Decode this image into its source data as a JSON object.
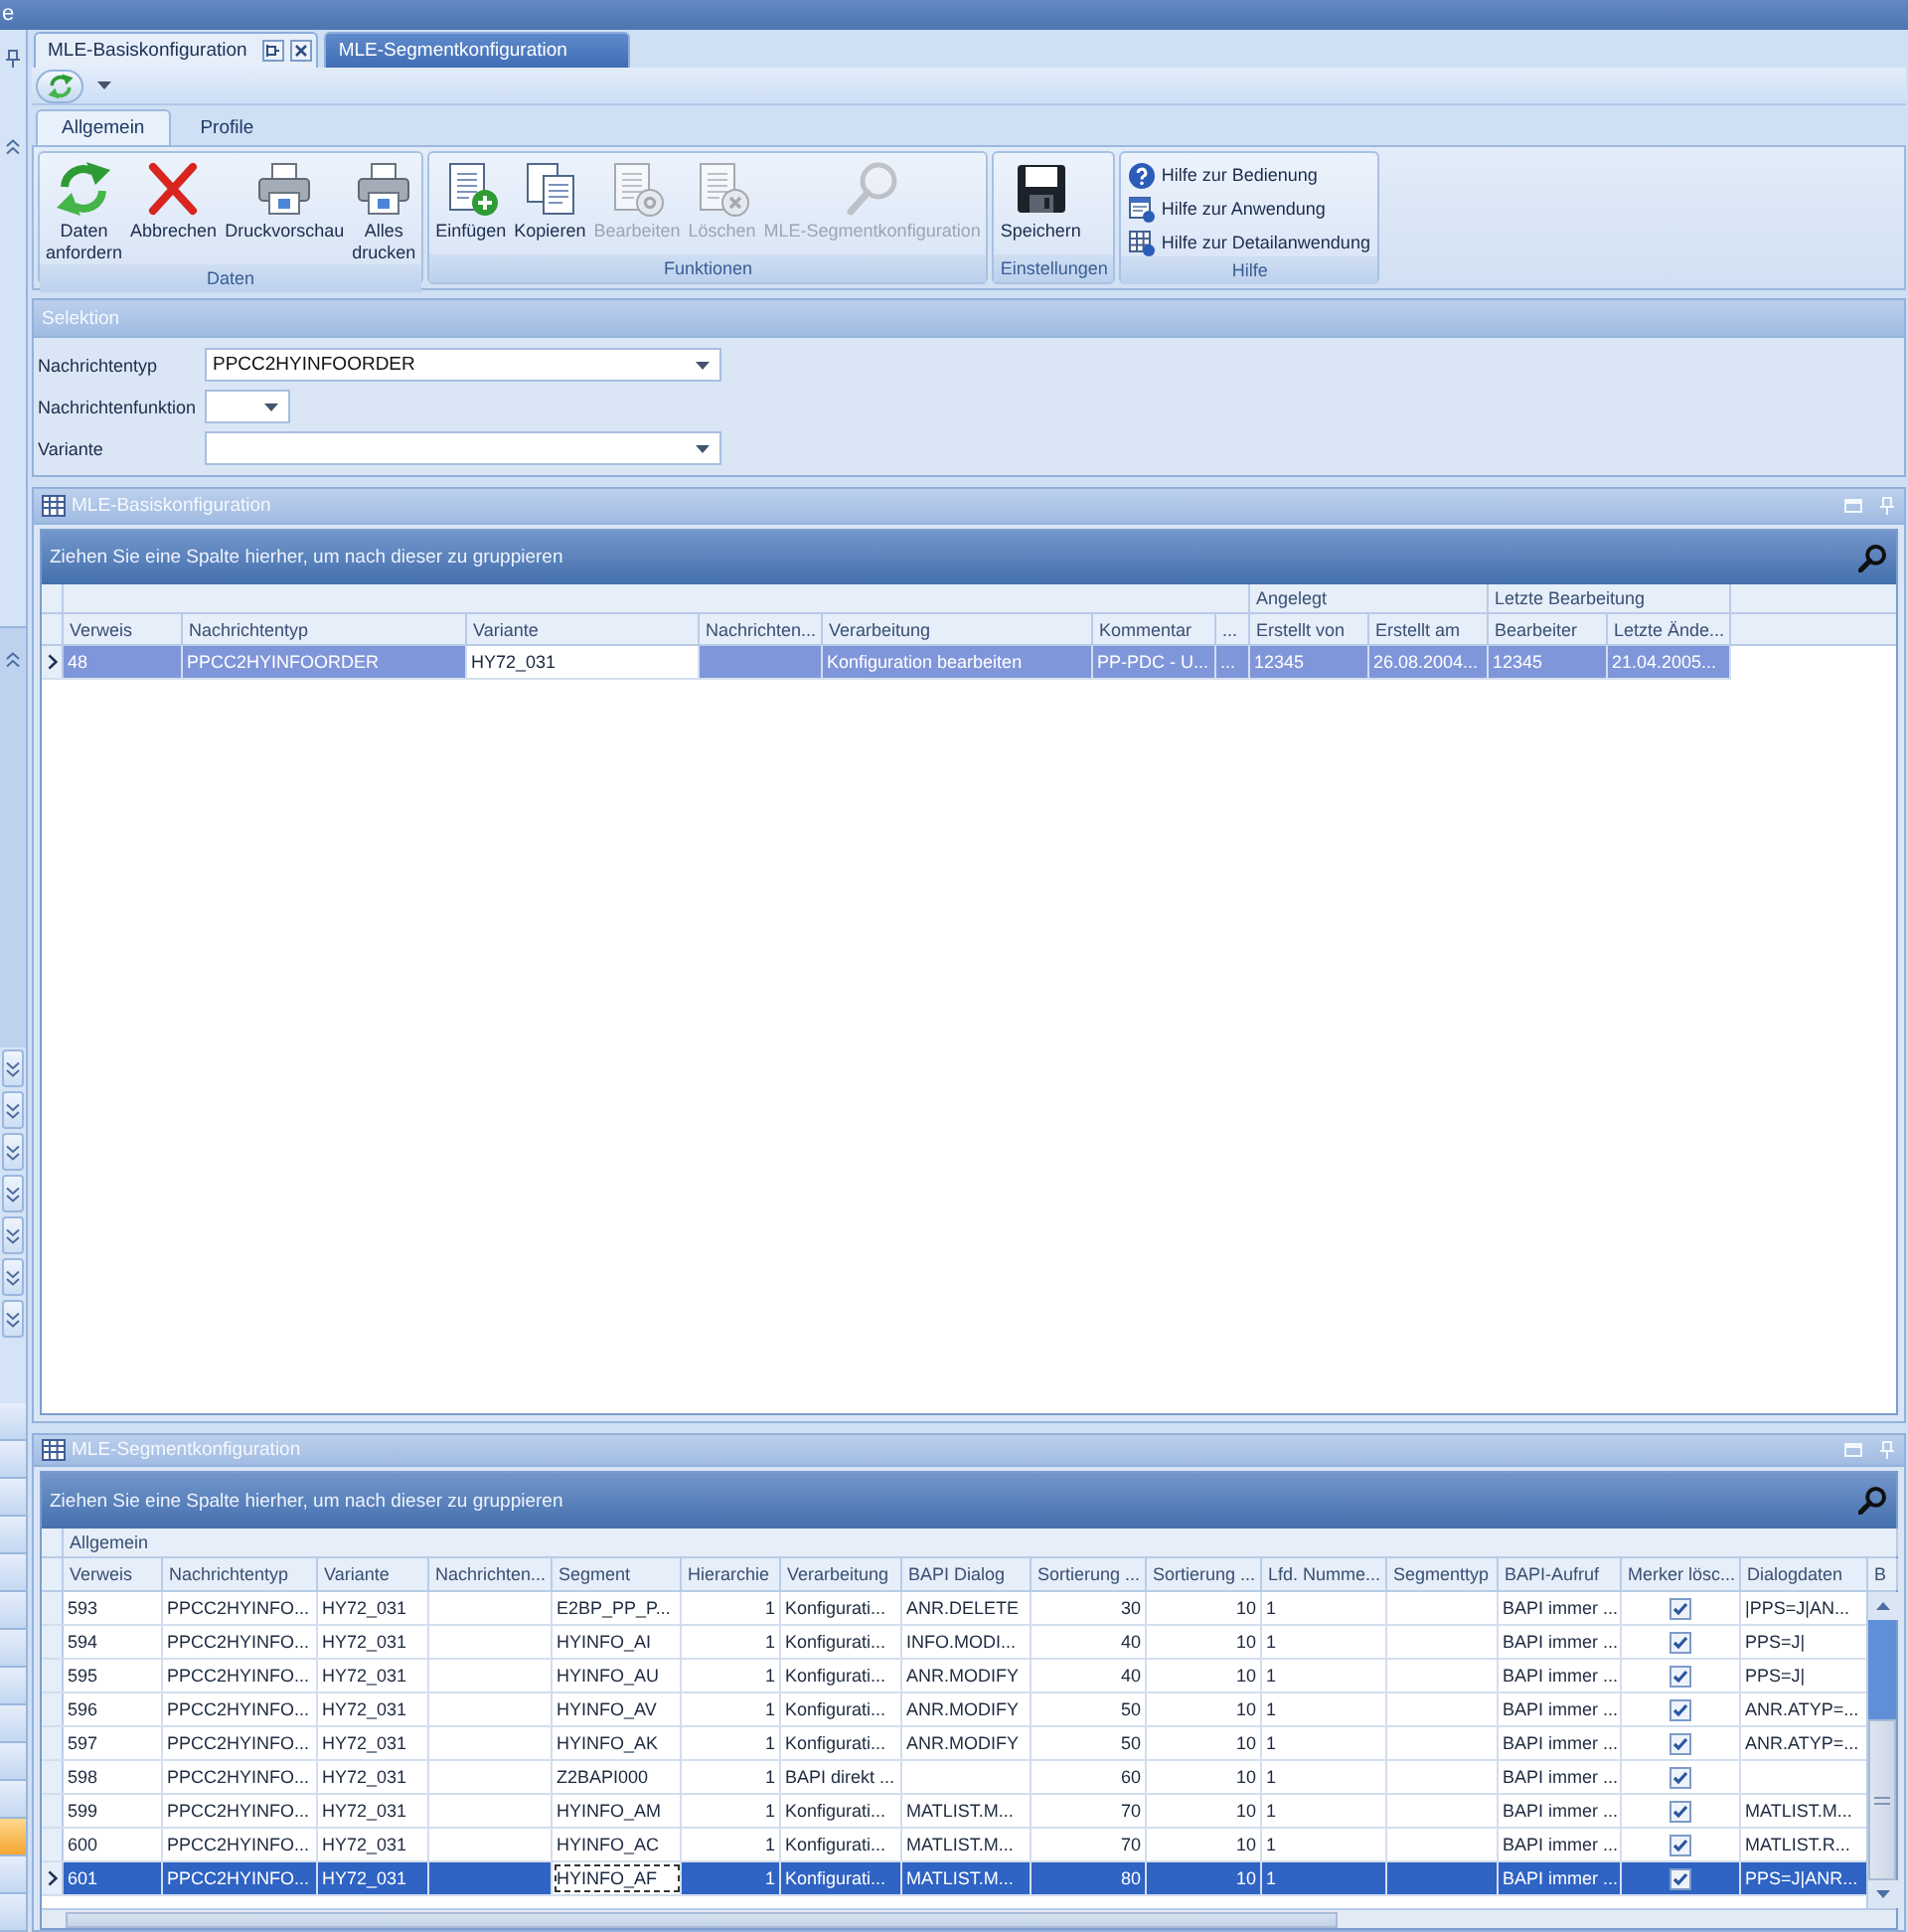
{
  "window": {
    "title": "e"
  },
  "nav_items": [
    {
      "selected": false
    },
    {
      "selected": false
    },
    {
      "selected": false
    },
    {
      "selected": false
    },
    {
      "selected": false
    },
    {
      "selected": false
    },
    {
      "selected": false
    },
    {
      "selected": false
    },
    {
      "selected": false
    },
    {
      "selected": false
    },
    {
      "selected": false
    },
    {
      "selected": true
    },
    {
      "selected": false
    },
    {
      "selected": false
    }
  ],
  "document_tabs": [
    {
      "label": "MLE-Basiskonfiguration",
      "selected": true
    },
    {
      "label": "MLE-Segmentkonfiguration",
      "selected": false
    }
  ],
  "ribbon": {
    "tabs": [
      {
        "label": "Allgemein",
        "selected": true
      },
      {
        "label": "Profile",
        "selected": false
      }
    ],
    "groups": [
      {
        "title": "Daten",
        "items": [
          {
            "kind": "large",
            "label": "Daten anfordern",
            "disabled": false
          },
          {
            "kind": "large",
            "label": "Abbrechen",
            "disabled": false
          },
          {
            "kind": "large",
            "label": "Druckvorschau",
            "disabled": false
          },
          {
            "kind": "large",
            "label": "Alles drucken",
            "disabled": false
          }
        ]
      },
      {
        "title": "Funktionen",
        "items": [
          {
            "kind": "large",
            "label": "Einfügen",
            "disabled": false
          },
          {
            "kind": "large",
            "label": "Kopieren",
            "disabled": false
          },
          {
            "kind": "large",
            "label": "Bearbeiten",
            "disabled": true
          },
          {
            "kind": "large",
            "label": "Löschen",
            "disabled": true
          },
          {
            "kind": "large",
            "label": "MLE-Segmentkonfiguration",
            "disabled": true
          }
        ]
      },
      {
        "title": "Einstellungen",
        "items": [
          {
            "kind": "large",
            "label": "Speichern",
            "disabled": false
          }
        ]
      },
      {
        "title": "Hilfe",
        "items": [
          {
            "kind": "small",
            "label": "Hilfe zur Bedienung",
            "disabled": false
          },
          {
            "kind": "small",
            "label": "Hilfe zur Anwendung",
            "disabled": false
          },
          {
            "kind": "small",
            "label": "Hilfe zur Detailanwendung",
            "disabled": false
          }
        ]
      }
    ]
  },
  "selection": {
    "title": "Selektion",
    "fields": [
      {
        "label": "Nachrichtentyp",
        "value": "PPCC2HYINFOORDER"
      },
      {
        "label": "Nachrichtenfunktion"
      },
      {
        "label": "Variante"
      }
    ]
  },
  "base_panel": {
    "title": "MLE-Basiskonfiguration",
    "grid": {
      "focused": false,
      "group_hint": "Ziehen Sie eine Spalte hierher, um nach dieser zu gruppieren",
      "bands": [
        {
          "columns": [
            {
              "label": "Verweis",
              "kind": "text"
            },
            {
              "label": "Nachrichtentyp",
              "kind": "text"
            },
            {
              "label": "Variante",
              "kind": "text"
            },
            {
              "label": "Nachrichten...",
              "kind": "text"
            },
            {
              "label": "Verarbeitung",
              "kind": "text"
            },
            {
              "label": "Kommentar",
              "kind": "text"
            },
            {
              "label": "...",
              "kind": "text"
            }
          ]
        },
        {
          "label": "Angelegt",
          "columns": [
            {
              "label": "Erstellt von",
              "kind": "text"
            },
            {
              "label": "Erstellt am",
              "kind": "text"
            }
          ]
        },
        {
          "label": "Letzte Bearbeitung",
          "columns": [
            {
              "label": "Bearbeiter",
              "kind": "text"
            },
            {
              "label": "Letzte Ände...",
              "kind": "text"
            }
          ]
        }
      ],
      "rows": [
        {
          "selected": true,
          "cells": [
            "48",
            "PPCC2HYINFOORDER",
            "HY72_031",
            null,
            "Konfiguration bearbeiten",
            "PP-PDC - U...",
            "...",
            "12345",
            "26.08.2004...",
            "12345",
            "21.04.2005..."
          ],
          "focused_cells": [
            false,
            false,
            true,
            false,
            false,
            false,
            false,
            false,
            false,
            false,
            false
          ]
        }
      ]
    }
  },
  "segment_panel": {
    "title": "MLE-Segmentkonfiguration",
    "grid": {
      "focused": true,
      "group_hint": "Ziehen Sie eine Spalte hierher, um nach dieser zu gruppieren",
      "bands": [
        {
          "label": "Allgemein",
          "columns": [
            {
              "label": "Verweis",
              "kind": "text"
            },
            {
              "label": "Nachrichtentyp",
              "kind": "text"
            },
            {
              "label": "Variante",
              "kind": "text"
            },
            {
              "label": "Nachrichten...",
              "kind": "text"
            },
            {
              "label": "Segment",
              "kind": "text"
            },
            {
              "label": "Hierarchie",
              "kind": "number"
            },
            {
              "label": "Verarbeitung",
              "kind": "text"
            },
            {
              "label": "BAPI Dialog",
              "kind": "text"
            },
            {
              "label": "Sortierung ...",
              "kind": "number"
            },
            {
              "label": "Sortierung ...",
              "kind": "number"
            },
            {
              "label": "Lfd. Numme...",
              "kind": "text"
            },
            {
              "label": "Segmenttyp",
              "kind": "text"
            },
            {
              "label": "BAPI-Aufruf",
              "kind": "text"
            },
            {
              "label": "Merker lösc...",
              "kind": "check"
            },
            {
              "label": "Dialogdaten",
              "kind": "text"
            },
            {
              "label": "B"
            }
          ]
        }
      ],
      "rows": [
        {
          "selected": false,
          "cells": [
            "593",
            "PPCC2HYINFO...",
            "HY72_031",
            null,
            "E2BP_PP_P...",
            "1",
            "Konfigurati...",
            "ANR.DELETE",
            "30",
            "10",
            "1",
            null,
            "BAPI immer ...",
            true,
            "|PPS=J|AN..."
          ]
        },
        {
          "selected": false,
          "cells": [
            "594",
            "PPCC2HYINFO...",
            "HY72_031",
            null,
            "HYINFO_AI",
            "1",
            "Konfigurati...",
            "INFO.MODI...",
            "40",
            "10",
            "1",
            null,
            "BAPI immer ...",
            true,
            "PPS=J|"
          ]
        },
        {
          "selected": false,
          "cells": [
            "595",
            "PPCC2HYINFO...",
            "HY72_031",
            null,
            "HYINFO_AU",
            "1",
            "Konfigurati...",
            "ANR.MODIFY",
            "40",
            "10",
            "1",
            null,
            "BAPI immer ...",
            true,
            "PPS=J|"
          ]
        },
        {
          "selected": false,
          "cells": [
            "596",
            "PPCC2HYINFO...",
            "HY72_031",
            null,
            "HYINFO_AV",
            "1",
            "Konfigurati...",
            "ANR.MODIFY",
            "50",
            "10",
            "1",
            null,
            "BAPI immer ...",
            true,
            "ANR.ATYP=..."
          ]
        },
        {
          "selected": false,
          "cells": [
            "597",
            "PPCC2HYINFO...",
            "HY72_031",
            null,
            "HYINFO_AK",
            "1",
            "Konfigurati...",
            "ANR.MODIFY",
            "50",
            "10",
            "1",
            null,
            "BAPI immer ...",
            true,
            "ANR.ATYP=..."
          ]
        },
        {
          "selected": false,
          "cells": [
            "598",
            "PPCC2HYINFO...",
            "HY72_031",
            null,
            "Z2BAPI000",
            "1",
            "BAPI direkt ...",
            null,
            "60",
            "10",
            "1",
            null,
            "BAPI immer ...",
            true,
            null
          ]
        },
        {
          "selected": false,
          "cells": [
            "599",
            "PPCC2HYINFO...",
            "HY72_031",
            null,
            "HYINFO_AM",
            "1",
            "Konfigurati...",
            "MATLIST.M...",
            "70",
            "10",
            "1",
            null,
            "BAPI immer ...",
            true,
            "MATLIST.M..."
          ]
        },
        {
          "selected": false,
          "cells": [
            "600",
            "PPCC2HYINFO...",
            "HY72_031",
            null,
            "HYINFO_AC",
            "1",
            "Konfigurati...",
            "MATLIST.M...",
            "70",
            "10",
            "1",
            null,
            "BAPI immer ...",
            true,
            "MATLIST.R..."
          ]
        },
        {
          "selected": true,
          "cells": [
            "601",
            "PPCC2HYINFO...",
            "HY72_031",
            null,
            "HYINFO_AF",
            "1",
            "Konfigurati...",
            "MATLIST.M...",
            "80",
            "10",
            "1",
            null,
            "BAPI immer ...",
            true,
            "PPS=J|ANR..."
          ],
          "focused_cells": [
            false,
            false,
            false,
            false,
            true,
            false,
            false,
            false,
            false,
            false,
            false,
            false,
            false,
            false,
            false
          ]
        }
      ]
    }
  }
}
